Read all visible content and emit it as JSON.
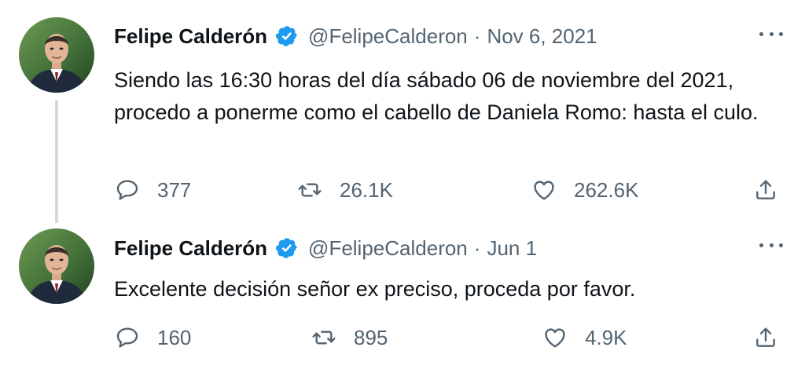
{
  "tweets": [
    {
      "author": {
        "name": "Felipe Calderón",
        "handle": "@FelipeCalderon",
        "verified": true
      },
      "separator": "·",
      "date": "Nov 6, 2021",
      "text": "Siendo las 16:30 horas del día sábado 06 de noviembre del 2021, procedo a ponerme como el cabello de Daniela Romo: hasta el culo.",
      "stats": {
        "replies": "377",
        "retweets": "26.1K",
        "likes": "262.6K"
      }
    },
    {
      "author": {
        "name": "Felipe Calderón",
        "handle": "@FelipeCalderon",
        "verified": true
      },
      "separator": "·",
      "date": "Jun 1",
      "text": "Excelente decisión señor ex preciso, proceda por favor.",
      "stats": {
        "replies": "160",
        "retweets": "895",
        "likes": "4.9K"
      }
    }
  ],
  "icons": {
    "verified": "verified-badge-icon",
    "more": "more-icon",
    "reply": "reply-icon",
    "retweet": "retweet-icon",
    "like": "like-icon",
    "share": "share-icon"
  },
  "colors": {
    "verified_blue": "#1d9bf0",
    "secondary_text": "#536471",
    "primary_text": "#0f1419",
    "thread_line": "#cfd9de"
  }
}
